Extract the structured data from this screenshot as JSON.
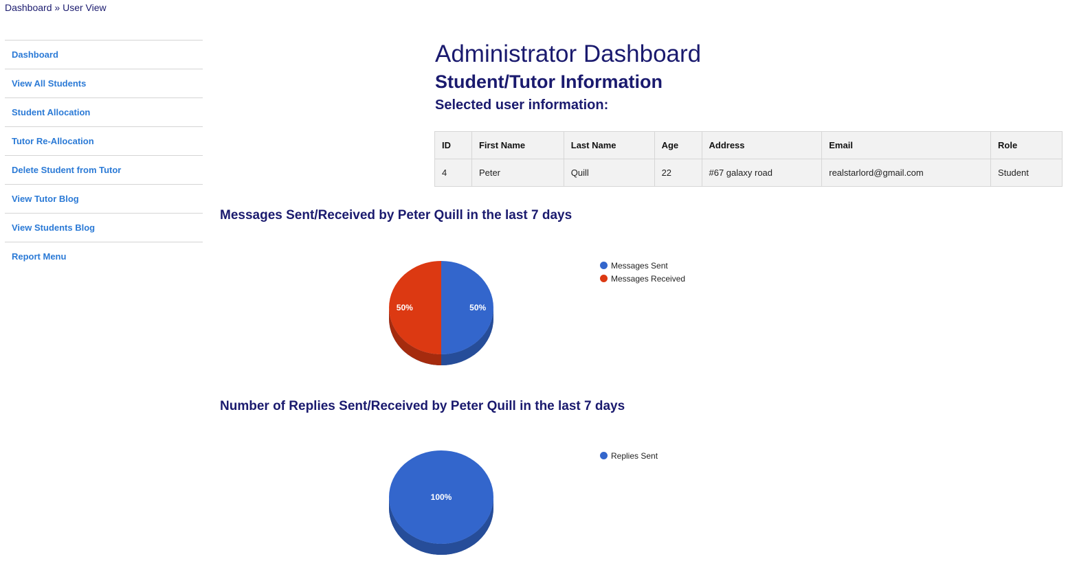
{
  "breadcrumb": {
    "home": "Dashboard",
    "separator": "»",
    "current": "User View"
  },
  "sidebar": {
    "items": [
      {
        "label": "Dashboard"
      },
      {
        "label": "View All Students"
      },
      {
        "label": "Student Allocation"
      },
      {
        "label": "Tutor Re-Allocation"
      },
      {
        "label": "Delete Student from Tutor"
      },
      {
        "label": "View Tutor Blog"
      },
      {
        "label": "View Students Blog"
      },
      {
        "label": "Report Menu"
      }
    ]
  },
  "header": {
    "title": "Administrator Dashboard",
    "subtitle": "Student/Tutor Information",
    "section": "Selected user information:"
  },
  "table": {
    "columns": [
      "ID",
      "First Name",
      "Last Name",
      "Age",
      "Address",
      "Email",
      "Role"
    ],
    "rows": [
      [
        "4",
        "Peter",
        "Quill",
        "22",
        "#67 galaxy road",
        "realstarlord@gmail.com",
        "Student"
      ]
    ]
  },
  "colors": {
    "accent_blue": "#3366cc",
    "accent_red": "#dc3912",
    "link": "#2b7ad6",
    "heading": "#1a1a6e"
  },
  "chart_data": [
    {
      "type": "pie",
      "title": "Messages Sent/Received by Peter Quill in the last 7 days",
      "categories": [
        "Messages Sent",
        "Messages Received"
      ],
      "values": [
        50,
        50
      ],
      "labels": [
        "50%",
        "50%"
      ],
      "colors": [
        "#3366cc",
        "#dc3912"
      ],
      "legend": "right"
    },
    {
      "type": "pie",
      "title": "Number of Replies Sent/Received by Peter Quill in the last 7 days",
      "categories": [
        "Replies Sent"
      ],
      "values": [
        100
      ],
      "labels": [
        "100%"
      ],
      "colors": [
        "#3366cc"
      ],
      "legend": "right"
    }
  ]
}
